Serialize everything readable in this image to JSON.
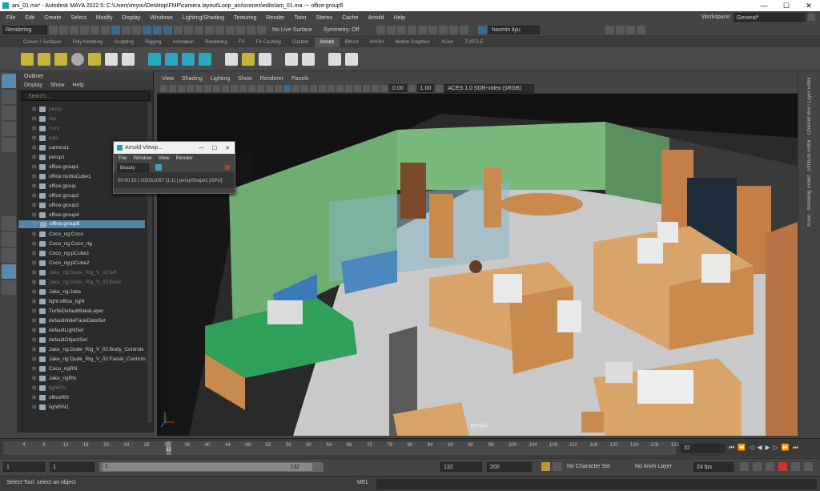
{
  "title_bar": {
    "text": "ani_01.ma* - Autodesk MAYA 2022.5: C:\\Users\\imyou\\Desktop\\FMP\\camera layout\\Loop_ani\\scenes\\edits\\ani_01.ma   ---   office:group5"
  },
  "menus": [
    "File",
    "Edit",
    "Create",
    "Select",
    "Modify",
    "Display",
    "Windows",
    "Lighting/Shading",
    "Texturing",
    "Render",
    "Toon",
    "Stereo",
    "Cache",
    "Arnold",
    "Help"
  ],
  "workspace": {
    "label": "Workspace:",
    "value": "General*"
  },
  "status_line": {
    "menu_set": "Rendering",
    "live_surface": "No Live Surface",
    "symmetry": "Symmetry: Off",
    "user": "haomin liyu"
  },
  "shelf_tabs": [
    "Curves / Surfaces",
    "Poly Modeling",
    "Sculpting",
    "Rigging",
    "Animation",
    "Rendering",
    "FX",
    "FX Caching",
    "Custom",
    "Arnold",
    "Bifrost",
    "MASH",
    "Motion Graphics",
    "XGen",
    "TURTLE"
  ],
  "shelf_active": "Arnold",
  "outliner": {
    "title": "Outliner",
    "menu": [
      "Display",
      "Show",
      "Help"
    ],
    "search_placeholder": "Search...",
    "items": [
      {
        "label": "persp",
        "dim": true
      },
      {
        "label": "top",
        "dim": true
      },
      {
        "label": "front",
        "dim": true
      },
      {
        "label": "side",
        "dim": true
      },
      {
        "label": "camera1",
        "dim": false
      },
      {
        "label": "persp1",
        "dim": false
      },
      {
        "label": "office:group1",
        "dim": false
      },
      {
        "label": "office:nurbsCube1",
        "dim": false
      },
      {
        "label": "office:group",
        "dim": false
      },
      {
        "label": "office:group2",
        "dim": false
      },
      {
        "label": "office:group3",
        "dim": false
      },
      {
        "label": "office:group4",
        "dim": false
      },
      {
        "label": "office:group5",
        "dim": false,
        "selected": true
      },
      {
        "label": "Coco_rig:Coco",
        "dim": false
      },
      {
        "label": "Coco_rig:Coco_rig",
        "dim": false
      },
      {
        "label": "Coco_rig:pCube1",
        "dim": false
      },
      {
        "label": "Coco_rig:pCube2",
        "dim": false
      },
      {
        "label": "Jake_rig:Dude_Rig_V_02:left",
        "dim": true
      },
      {
        "label": "Jake_rig:Dude_Rig_V_02:Back",
        "dim": true
      },
      {
        "label": "Jake_rig:Jake",
        "dim": false
      },
      {
        "label": "light:office_light",
        "dim": false
      },
      {
        "label": "TurtleDefaultBakeLayer",
        "dim": false
      },
      {
        "label": "defaultHideFaceDataSet",
        "dim": false
      },
      {
        "label": "defaultLightSet",
        "dim": false
      },
      {
        "label": "defaultObjectSet",
        "dim": false
      },
      {
        "label": "Jake_rig:Dude_Rig_V_02:Body_Controls",
        "dim": false
      },
      {
        "label": "Jake_rig:Dude_Rig_V_02:Facial_Controls",
        "dim": false
      },
      {
        "label": "Coco_rigRN",
        "dim": false
      },
      {
        "label": "Jake_rigRN",
        "dim": false
      },
      {
        "label": "lightRN",
        "dim": true
      },
      {
        "label": "officeRN",
        "dim": false
      },
      {
        "label": "lightRN1",
        "dim": false
      }
    ]
  },
  "viewport": {
    "menu": [
      "View",
      "Shading",
      "Lighting",
      "Show",
      "Renderer",
      "Panels"
    ],
    "exposure": "0.00",
    "gamma": "1.00",
    "color_space": "ACES 1.0 SDR-video (sRGB)",
    "camera_label": "persp1"
  },
  "arnold_viewer": {
    "title": "Arnold Viewp...",
    "menu": [
      "File",
      "Window",
      "View",
      "Render"
    ],
    "aov": "Beauty",
    "status": "00:00:10 | 2033x1067 (1:1) | perspShape1 [GPU]"
  },
  "right_panels": [
    "Channel Box / Layer Editor",
    "Attribute Editor",
    "Modeling Toolkit",
    "XGen"
  ],
  "timeline": {
    "ticks": [
      "4",
      "8",
      "12",
      "16",
      "20",
      "24",
      "28",
      "32",
      "36",
      "40",
      "44",
      "48",
      "52",
      "56",
      "60",
      "64",
      "68",
      "72",
      "76",
      "80",
      "84",
      "88",
      "92",
      "96",
      "100",
      "104",
      "108",
      "112",
      "116",
      "120",
      "124",
      "128",
      "132"
    ],
    "current_frame": "32",
    "current_field": "32"
  },
  "range": {
    "start_field": "1",
    "start_inner": "1",
    "range_start": "1",
    "range_end": "132",
    "end_inner": "132",
    "end_field": "200",
    "char_set": "No Character Set",
    "anim_layer": "No Anim Layer",
    "fps": "24 fps"
  },
  "command_line": {
    "help": "Select Tool: select an object",
    "mel": "MEL"
  },
  "colors": {
    "accent": "#5285a6",
    "bg": "#444444",
    "panel": "#2b2b2b",
    "arnold_icon": "#1aaaaa"
  }
}
